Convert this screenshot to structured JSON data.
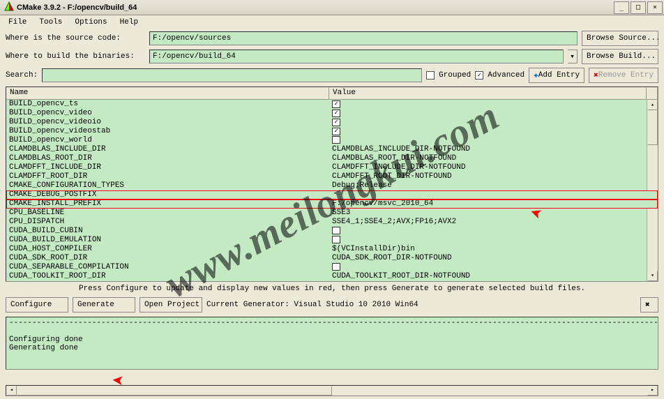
{
  "window": {
    "title": "CMake 3.9.2 - F:/opencv/build_64"
  },
  "menu": {
    "file": "File",
    "tools": "Tools",
    "options": "Options",
    "help": "Help"
  },
  "paths": {
    "source_label": "Where is the source code:",
    "source_value": "F:/opencv/sources",
    "build_label": "Where to build the binaries:",
    "build_value": "F:/opencv/build_64",
    "browse_source": "Browse Source...",
    "browse_build": "Browse Build..."
  },
  "filter": {
    "search_label": "Search:",
    "grouped_label": "Grouped",
    "advanced_label": "Advanced",
    "advanced_checked": "✓",
    "add_entry": "Add Entry",
    "remove_entry": "Remove Entry"
  },
  "headers": {
    "name": "Name",
    "value": "Value"
  },
  "rows": [
    {
      "name": "BUILD_opencv_ts",
      "type": "check",
      "checked": true
    },
    {
      "name": "BUILD_opencv_video",
      "type": "check",
      "checked": true
    },
    {
      "name": "BUILD_opencv_videoio",
      "type": "check",
      "checked": true
    },
    {
      "name": "BUILD_opencv_videostab",
      "type": "check",
      "checked": true
    },
    {
      "name": "BUILD_opencv_world",
      "type": "check",
      "checked": false
    },
    {
      "name": "CLAMDBLAS_INCLUDE_DIR",
      "type": "text",
      "value": "CLAMDBLAS_INCLUDE_DIR-NOTFOUND"
    },
    {
      "name": "CLAMDBLAS_ROOT_DIR",
      "type": "text",
      "value": "CLAMDBLAS_ROOT_DIR-NOTFOUND"
    },
    {
      "name": "CLAMDFFT_INCLUDE_DIR",
      "type": "text",
      "value": "CLAMDFFT_INCLUDE_DIR-NOTFOUND"
    },
    {
      "name": "CLAMDFFT_ROOT_DIR",
      "type": "text",
      "value": "CLAMDFFT_ROOT_DIR-NOTFOUND"
    },
    {
      "name": "CMAKE_CONFIGURATION_TYPES",
      "type": "text",
      "value": "Debug;Release"
    },
    {
      "name": "CMAKE_DEBUG_POSTFIX",
      "type": "text",
      "value": "",
      "highlight": true
    },
    {
      "name": "CMAKE_INSTALL_PREFIX",
      "type": "text",
      "value": "F:/opencv/msvc_2010_64",
      "highlight": true
    },
    {
      "name": "CPU_BASELINE",
      "type": "text",
      "value": "SSE3"
    },
    {
      "name": "CPU_DISPATCH",
      "type": "text",
      "value": "SSE4_1;SSE4_2;AVX;FP16;AVX2"
    },
    {
      "name": "CUDA_BUILD_CUBIN",
      "type": "check",
      "checked": false
    },
    {
      "name": "CUDA_BUILD_EMULATION",
      "type": "check",
      "checked": false
    },
    {
      "name": "CUDA_HOST_COMPILER",
      "type": "text",
      "value": "$(VCInstallDir)bin"
    },
    {
      "name": "CUDA_SDK_ROOT_DIR",
      "type": "text",
      "value": "CUDA_SDK_ROOT_DIR-NOTFOUND"
    },
    {
      "name": "CUDA_SEPARABLE_COMPILATION",
      "type": "check",
      "checked": false
    },
    {
      "name": "CUDA_TOOLKIT_ROOT_DIR",
      "type": "text",
      "value": "CUDA_TOOLKIT_ROOT_DIR-NOTFOUND"
    }
  ],
  "hint": "Press Configure to update and display new values in red,  then press Generate to generate selected build files.",
  "buttons": {
    "configure": "Configure",
    "generate": "Generate",
    "open_project": "Open Project",
    "generator_label": "Current Generator: Visual Studio 10 2010 Win64"
  },
  "log": {
    "dashes": "----------------------------------------------------------------------------------------------------------------------------------------------------------------",
    "line1": "Configuring done",
    "line2": "Generating done"
  },
  "watermark": "www.meilongkui.com"
}
